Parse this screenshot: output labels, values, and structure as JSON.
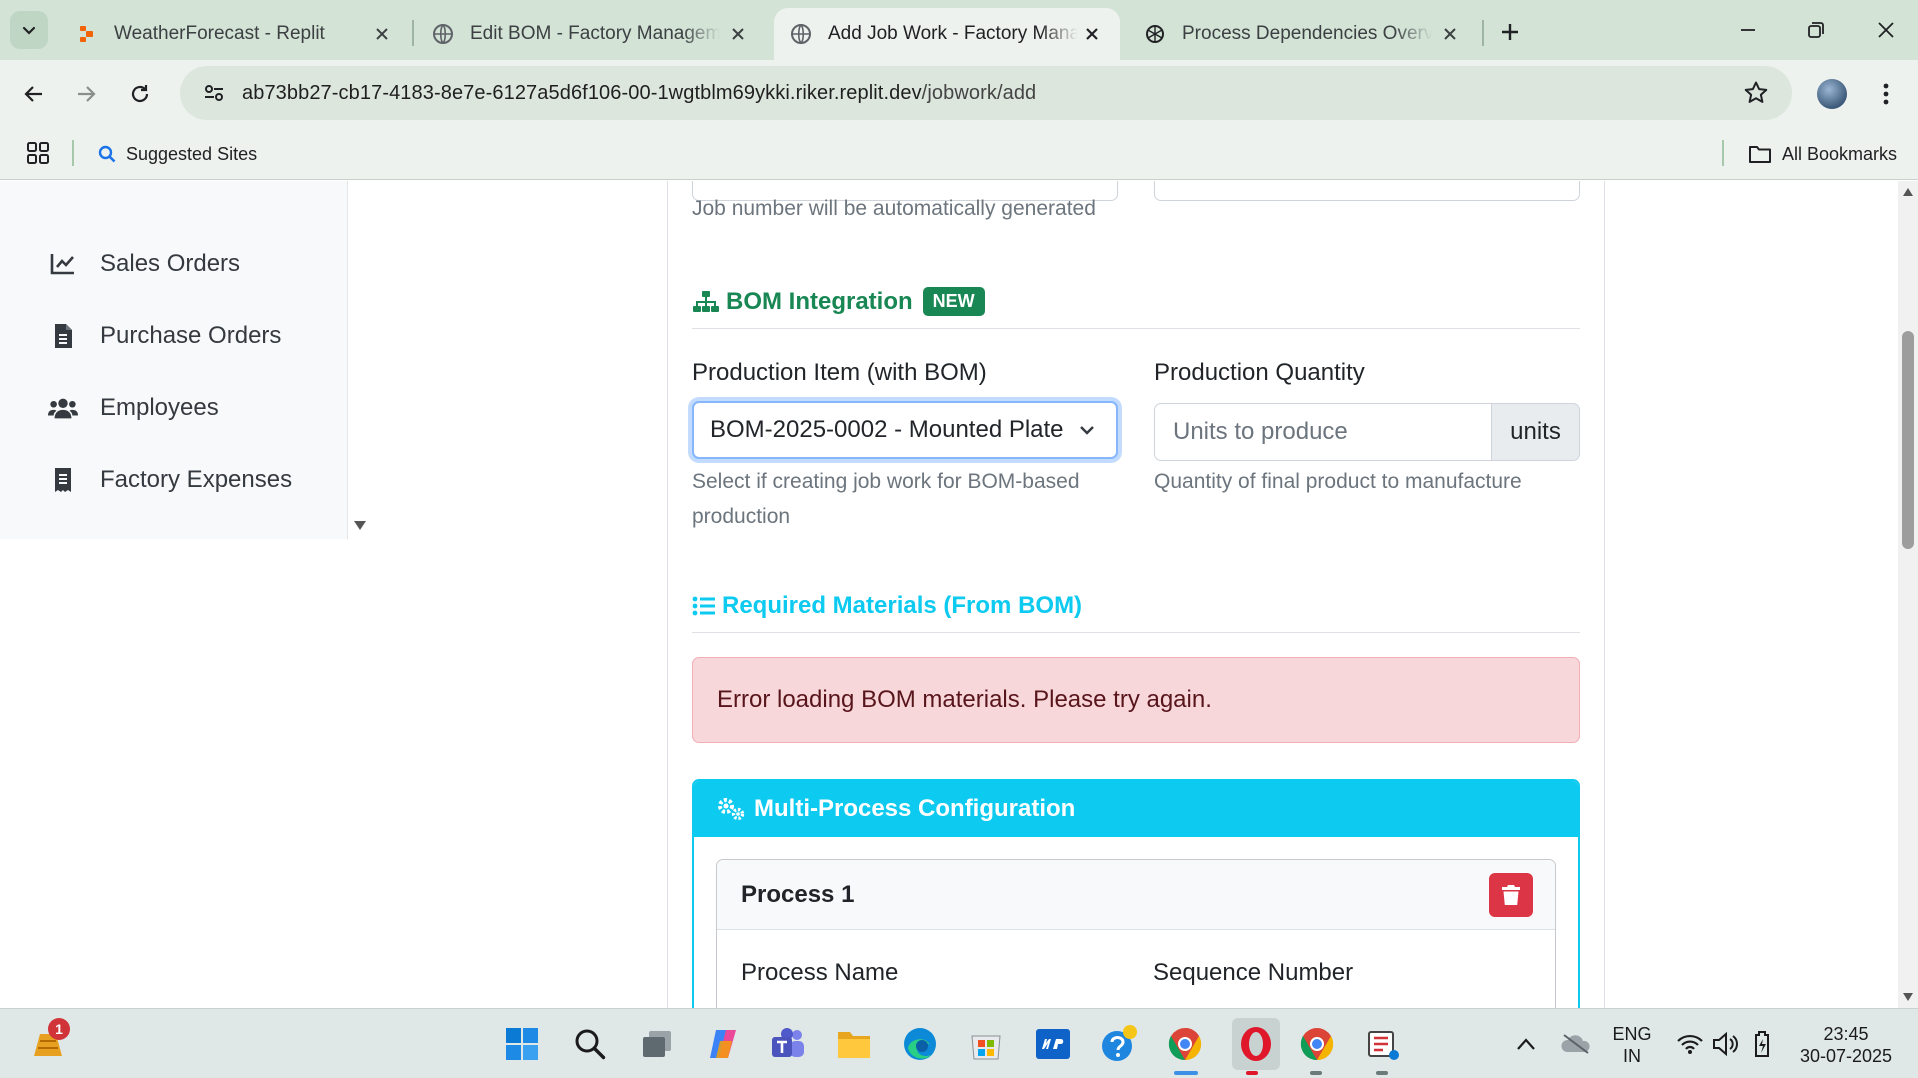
{
  "browser": {
    "tabs": [
      {
        "title": "WeatherForecast - Replit",
        "active": false
      },
      {
        "title": "Edit BOM - Factory Management",
        "active": false
      },
      {
        "title": "Add Job Work - Factory Management",
        "active": true
      },
      {
        "title": "Process Dependencies Overview",
        "active": false
      }
    ],
    "url_host": "ab73bb27-cb17-4183-8e7e-6127a5d6f106-00-1wgtblm69ykki.riker.replit.dev",
    "url_path": "/jobwork/add",
    "bookmarks": {
      "suggested": "Suggested Sites",
      "all": "All Bookmarks"
    }
  },
  "sidebar": {
    "items": [
      {
        "label": "Sales Orders",
        "icon": "chart-line-icon"
      },
      {
        "label": "Purchase Orders",
        "icon": "file-invoice-icon"
      },
      {
        "label": "Employees",
        "icon": "users-icon"
      },
      {
        "label": "Factory Expenses",
        "icon": "receipt-icon"
      }
    ]
  },
  "form": {
    "job_number_help": "Job number will be automatically generated",
    "bom_section": {
      "title": "BOM Integration",
      "badge": "NEW"
    },
    "production_item": {
      "label": "Production Item (with BOM)",
      "value": "BOM-2025-0002 - Mounted Plate",
      "help": "Select if creating job work for BOM-based production"
    },
    "production_quantity": {
      "label": "Production Quantity",
      "placeholder": "Units to produce",
      "unit": "units",
      "help": "Quantity of final product to manufacture"
    },
    "materials_section": {
      "title": "Required Materials (From BOM)"
    },
    "error_alert": "Error loading BOM materials. Please try again.",
    "multi_process": {
      "title": "Multi-Process Configuration",
      "process_title": "Process 1",
      "process_name_label": "Process Name",
      "sequence_label": "Sequence Number"
    }
  },
  "taskbar": {
    "notification_count": "1",
    "language": "ENG",
    "region": "IN",
    "time": "23:45",
    "date": "30-07-2025"
  },
  "colors": {
    "accent_green": "#198754",
    "info_cyan": "#0dcaf0",
    "danger": "#dc3545",
    "alert_bg": "#f8d7da"
  }
}
